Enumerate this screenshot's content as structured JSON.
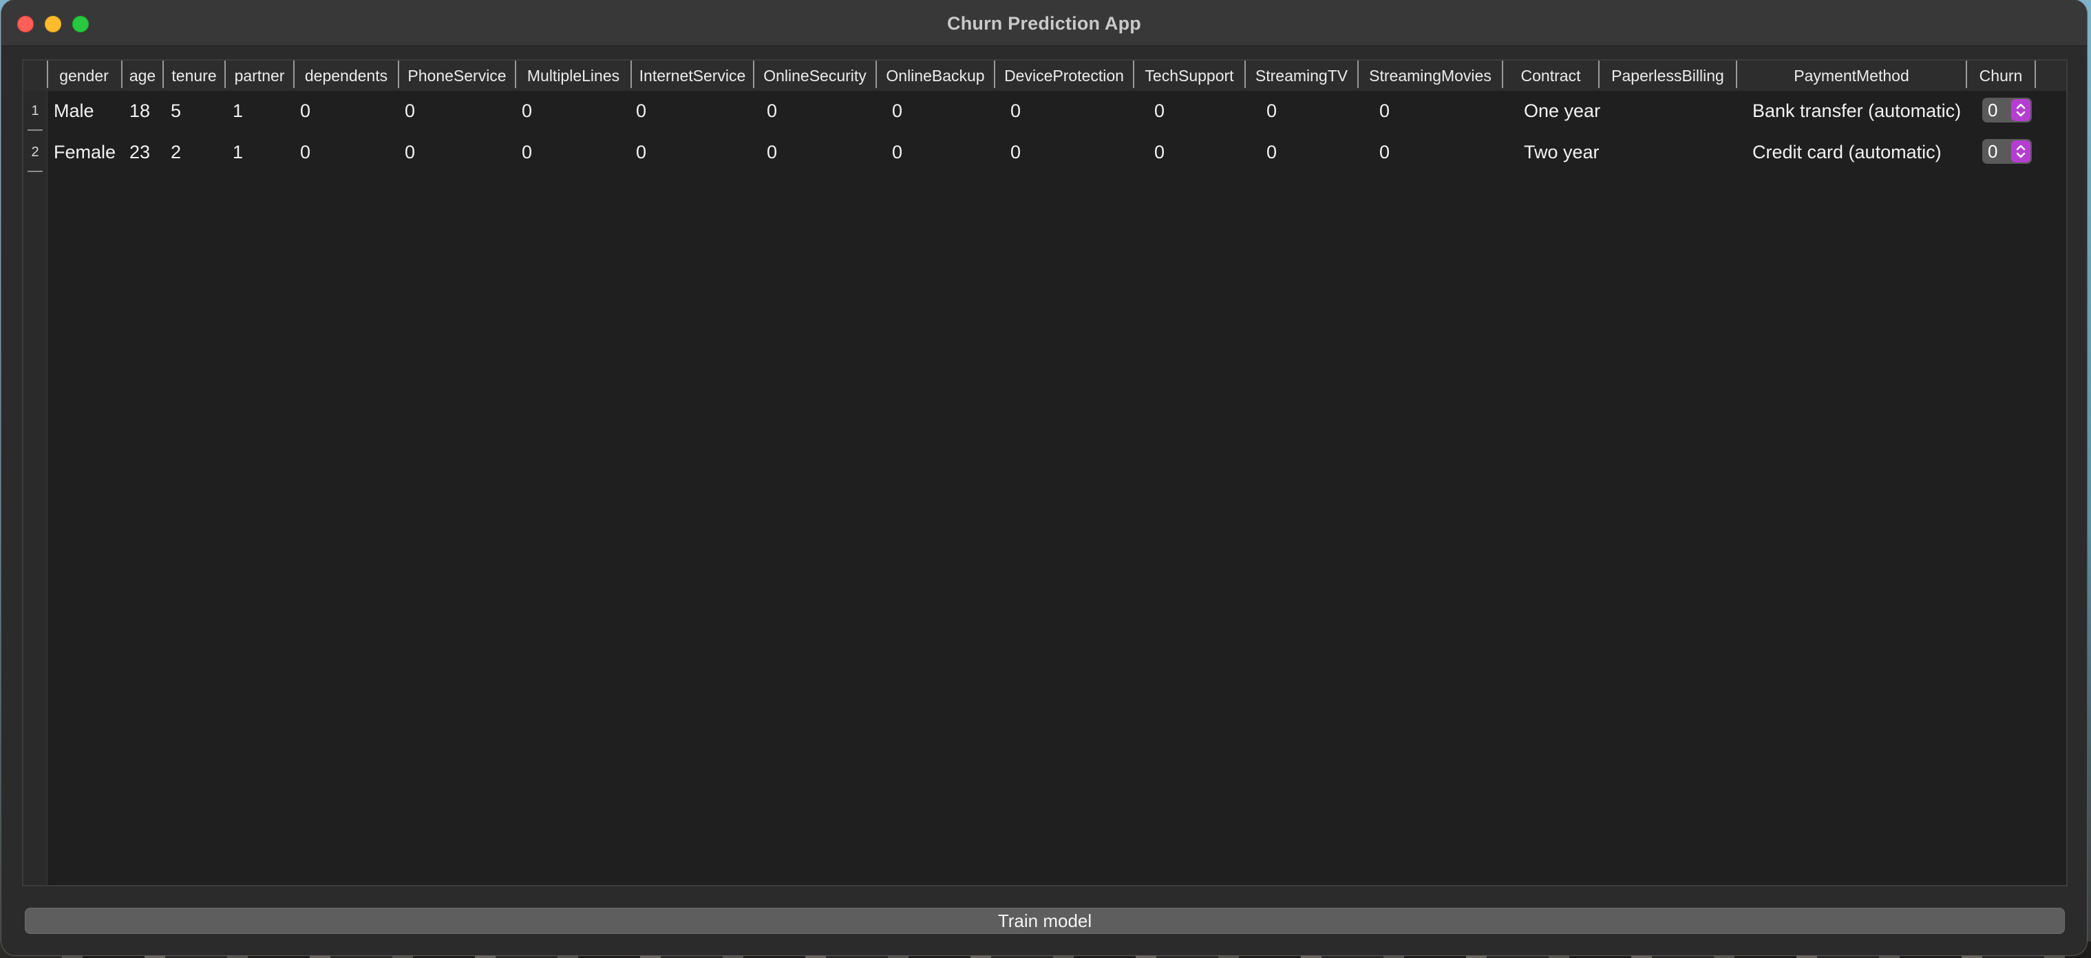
{
  "window": {
    "title": "Churn Prediction App"
  },
  "table": {
    "columns": [
      "gender",
      "age",
      "tenure",
      "partner",
      "dependents",
      "PhoneService",
      "MultipleLines",
      "InternetService",
      "OnlineSecurity",
      "OnlineBackup",
      "DeviceProtection",
      "TechSupport",
      "StreamingTV",
      "StreamingMovies",
      "Contract",
      "PaperlessBilling",
      "PaymentMethod",
      "Churn"
    ],
    "row_numbers": [
      "1",
      "2"
    ],
    "rows": [
      [
        "Male",
        "18",
        "5",
        "1",
        "0",
        "0",
        "0",
        "0",
        "0",
        "0",
        "0",
        "0",
        "0",
        "0",
        "One year",
        "",
        "Bank transfer (automatic)",
        "0"
      ],
      [
        "Female",
        "23",
        "2",
        "1",
        "0",
        "0",
        "0",
        "0",
        "0",
        "0",
        "0",
        "0",
        "0",
        "0",
        "Two year",
        "",
        "Credit card (automatic)",
        "0"
      ]
    ]
  },
  "actions": {
    "train_label": "Train model"
  },
  "colors": {
    "accent": "#b43fcf",
    "window_bg": "#2b2b2b",
    "table_bg": "#1f1f1f"
  },
  "icons": {
    "spinner": "chevron-up-down-icon"
  }
}
